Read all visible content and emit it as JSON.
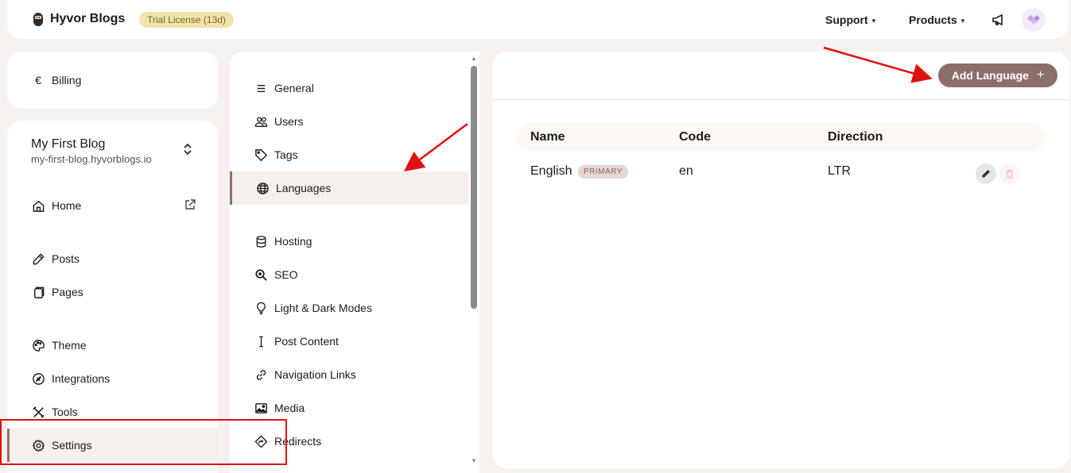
{
  "header": {
    "app_title": "Hyvor Blogs",
    "trial_badge": "Trial License (13d)",
    "support": "Support",
    "products": "Products",
    "caret": "▾"
  },
  "sidebar": {
    "billing": {
      "icon": "€",
      "label": "Billing"
    },
    "blog": {
      "name": "My First Blog",
      "url": "my-first-blog.hyvorblogs.io"
    },
    "items": [
      {
        "label": "Home",
        "icon": "home-icon"
      },
      {
        "label": "Posts",
        "icon": "pencil-icon"
      },
      {
        "label": "Pages",
        "icon": "pages-icon"
      },
      {
        "label": "Theme",
        "icon": "palette-icon"
      },
      {
        "label": "Integrations",
        "icon": "plug-icon"
      },
      {
        "label": "Tools",
        "icon": "tools-icon"
      },
      {
        "label": "Settings",
        "icon": "gear-icon",
        "active": true
      }
    ]
  },
  "settings_menu": {
    "items": [
      {
        "label": "General",
        "icon": "list-icon"
      },
      {
        "label": "Users",
        "icon": "users-icon"
      },
      {
        "label": "Tags",
        "icon": "tag-icon"
      },
      {
        "label": "Languages",
        "icon": "globe-icon",
        "active": true
      },
      {
        "label": "Hosting",
        "icon": "database-icon"
      },
      {
        "label": "SEO",
        "icon": "search-icon"
      },
      {
        "label": "Light & Dark Modes",
        "icon": "bulb-icon"
      },
      {
        "label": "Post Content",
        "icon": "text-cursor-icon"
      },
      {
        "label": "Navigation Links",
        "icon": "link-icon"
      },
      {
        "label": "Media",
        "icon": "image-icon"
      },
      {
        "label": "Redirects",
        "icon": "redirect-icon"
      }
    ]
  },
  "main": {
    "add_button": {
      "label": "Add Language",
      "icon": "+"
    },
    "table": {
      "columns": [
        "Name",
        "Code",
        "Direction"
      ],
      "rows": [
        {
          "name": "English",
          "badge": "PRIMARY",
          "code": "en",
          "direction": "LTR"
        }
      ]
    }
  },
  "colors": {
    "accent": "#8c6e6a",
    "page_bg": "#f7f2ef",
    "trial_badge_bg": "#f2e3ad",
    "annotation_red": "#e01010"
  }
}
